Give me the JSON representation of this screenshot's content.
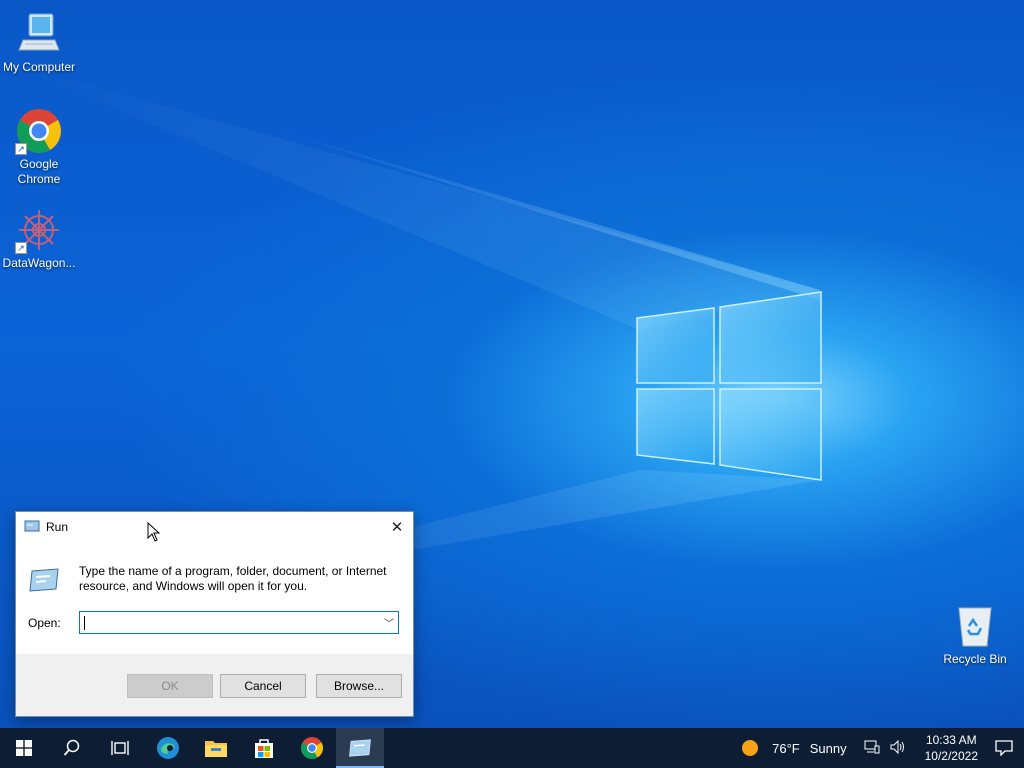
{
  "desktop": {
    "icons": [
      {
        "label": "My Computer"
      },
      {
        "label": "Google Chrome"
      },
      {
        "label": "DataWagon..."
      },
      {
        "label": "Recycle Bin"
      }
    ]
  },
  "run_dialog": {
    "title": "Run",
    "description": "Type the name of a program, folder, document, or Internet resource, and Windows will open it for you.",
    "open_label": "Open:",
    "input_value": "",
    "ok_label": "OK",
    "cancel_label": "Cancel",
    "browse_label": "Browse..."
  },
  "taskbar": {
    "weather_temp": "76°F",
    "weather_condition": "Sunny",
    "time": "10:33 AM",
    "date": "10/2/2022"
  }
}
